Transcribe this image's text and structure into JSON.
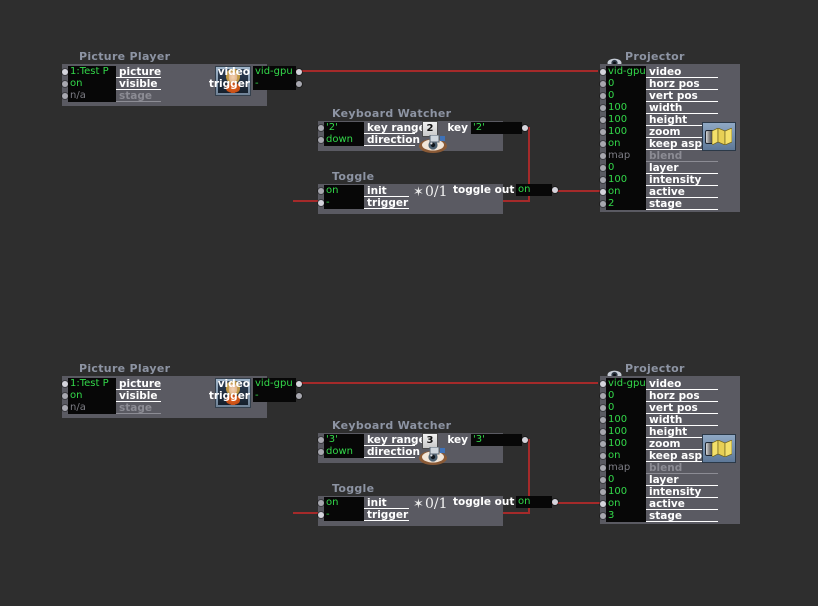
{
  "canvas": {
    "background": "#2e2e2e",
    "wire_color": "#a52a2a",
    "node_body_color": "#5a5a62",
    "field_bg": "#070707",
    "value_color": "#33d94a",
    "title_color": "#8d94a3"
  },
  "groups": [
    {
      "id": "group-top",
      "picture_player": {
        "title": "Picture Player",
        "inputs": [
          {
            "value": "1:Test P",
            "label": "picture",
            "dim": false
          },
          {
            "value": "on",
            "label": "visible",
            "dim": false
          },
          {
            "value": "n/a",
            "label": "stage",
            "dim": true
          }
        ],
        "outputs": [
          {
            "label": "video",
            "value": "vid-gpu",
            "connected": true
          },
          {
            "label": "trigger",
            "value": "-",
            "connected": false
          }
        ],
        "thumbnail": "picture-thumbnail"
      },
      "keyboard_watcher": {
        "title": "Keyboard Watcher",
        "inputs": [
          {
            "value": "'2'",
            "label": "key range"
          },
          {
            "value": "down",
            "label": "direction"
          }
        ],
        "badge": "2",
        "outputs": [
          {
            "label": "key",
            "value": "'2'",
            "connected": true
          }
        ],
        "icon": "eye-watcher-icon"
      },
      "toggle": {
        "title": "Toggle",
        "inputs": [
          {
            "value": "on",
            "label": "init",
            "connected": false
          },
          {
            "value": "-",
            "label": "trigger",
            "connected": true
          }
        ],
        "ratio": "0/1",
        "icon": "sun-icon",
        "outputs": [
          {
            "label": "toggle out",
            "value": "on",
            "connected": true
          }
        ]
      },
      "projector": {
        "title": "Projector",
        "icon": "eye-icon",
        "rows": [
          {
            "value": "vid-gpu",
            "label": "video",
            "dim": false,
            "connected": true
          },
          {
            "value": "0",
            "label": "horz pos",
            "dim": false,
            "connected": false
          },
          {
            "value": "0",
            "label": "vert pos",
            "dim": false,
            "connected": false
          },
          {
            "value": "100",
            "label": "width",
            "dim": false,
            "connected": false
          },
          {
            "value": "100",
            "label": "height",
            "dim": false,
            "connected": false
          },
          {
            "value": "100",
            "label": "zoom",
            "dim": false,
            "connected": false
          },
          {
            "value": "on",
            "label": "keep aspect",
            "dim": false,
            "connected": false
          },
          {
            "value": "map",
            "label": "blend",
            "dim": true,
            "connected": false
          },
          {
            "value": "0",
            "label": "layer",
            "dim": false,
            "connected": false
          },
          {
            "value": "100",
            "label": "intensity",
            "dim": false,
            "connected": false
          },
          {
            "value": "on",
            "label": "active",
            "dim": false,
            "connected": true
          },
          {
            "value": "2",
            "label": "stage",
            "dim": false,
            "connected": false
          }
        ],
        "map_icon": "map-icon"
      }
    },
    {
      "id": "group-bottom",
      "picture_player": {
        "title": "Picture Player",
        "inputs": [
          {
            "value": "1:Test P",
            "label": "picture",
            "dim": false
          },
          {
            "value": "on",
            "label": "visible",
            "dim": false
          },
          {
            "value": "n/a",
            "label": "stage",
            "dim": true
          }
        ],
        "outputs": [
          {
            "label": "video",
            "value": "vid-gpu",
            "connected": true
          },
          {
            "label": "trigger",
            "value": "-",
            "connected": false
          }
        ],
        "thumbnail": "picture-thumbnail"
      },
      "keyboard_watcher": {
        "title": "Keyboard Watcher",
        "inputs": [
          {
            "value": "'3'",
            "label": "key range"
          },
          {
            "value": "down",
            "label": "direction"
          }
        ],
        "badge": "3",
        "outputs": [
          {
            "label": "key",
            "value": "'3'",
            "connected": true
          }
        ],
        "icon": "eye-watcher-icon"
      },
      "toggle": {
        "title": "Toggle",
        "inputs": [
          {
            "value": "on",
            "label": "init",
            "connected": false
          },
          {
            "value": "-",
            "label": "trigger",
            "connected": true
          }
        ],
        "ratio": "0/1",
        "icon": "sun-icon",
        "outputs": [
          {
            "label": "toggle out",
            "value": "on",
            "connected": true
          }
        ]
      },
      "projector": {
        "title": "Projector",
        "icon": "eye-icon",
        "rows": [
          {
            "value": "vid-gpu",
            "label": "video",
            "dim": false,
            "connected": true
          },
          {
            "value": "0",
            "label": "horz pos",
            "dim": false,
            "connected": false
          },
          {
            "value": "0",
            "label": "vert pos",
            "dim": false,
            "connected": false
          },
          {
            "value": "100",
            "label": "width",
            "dim": false,
            "connected": false
          },
          {
            "value": "100",
            "label": "height",
            "dim": false,
            "connected": false
          },
          {
            "value": "100",
            "label": "zoom",
            "dim": false,
            "connected": false
          },
          {
            "value": "on",
            "label": "keep aspect",
            "dim": false,
            "connected": false
          },
          {
            "value": "map",
            "label": "blend",
            "dim": true,
            "connected": false
          },
          {
            "value": "0",
            "label": "layer",
            "dim": false,
            "connected": false
          },
          {
            "value": "100",
            "label": "intensity",
            "dim": false,
            "connected": false
          },
          {
            "value": "on",
            "label": "active",
            "dim": false,
            "connected": true
          },
          {
            "value": "3",
            "label": "stage",
            "dim": false,
            "connected": false
          }
        ],
        "map_icon": "map-icon"
      }
    }
  ]
}
